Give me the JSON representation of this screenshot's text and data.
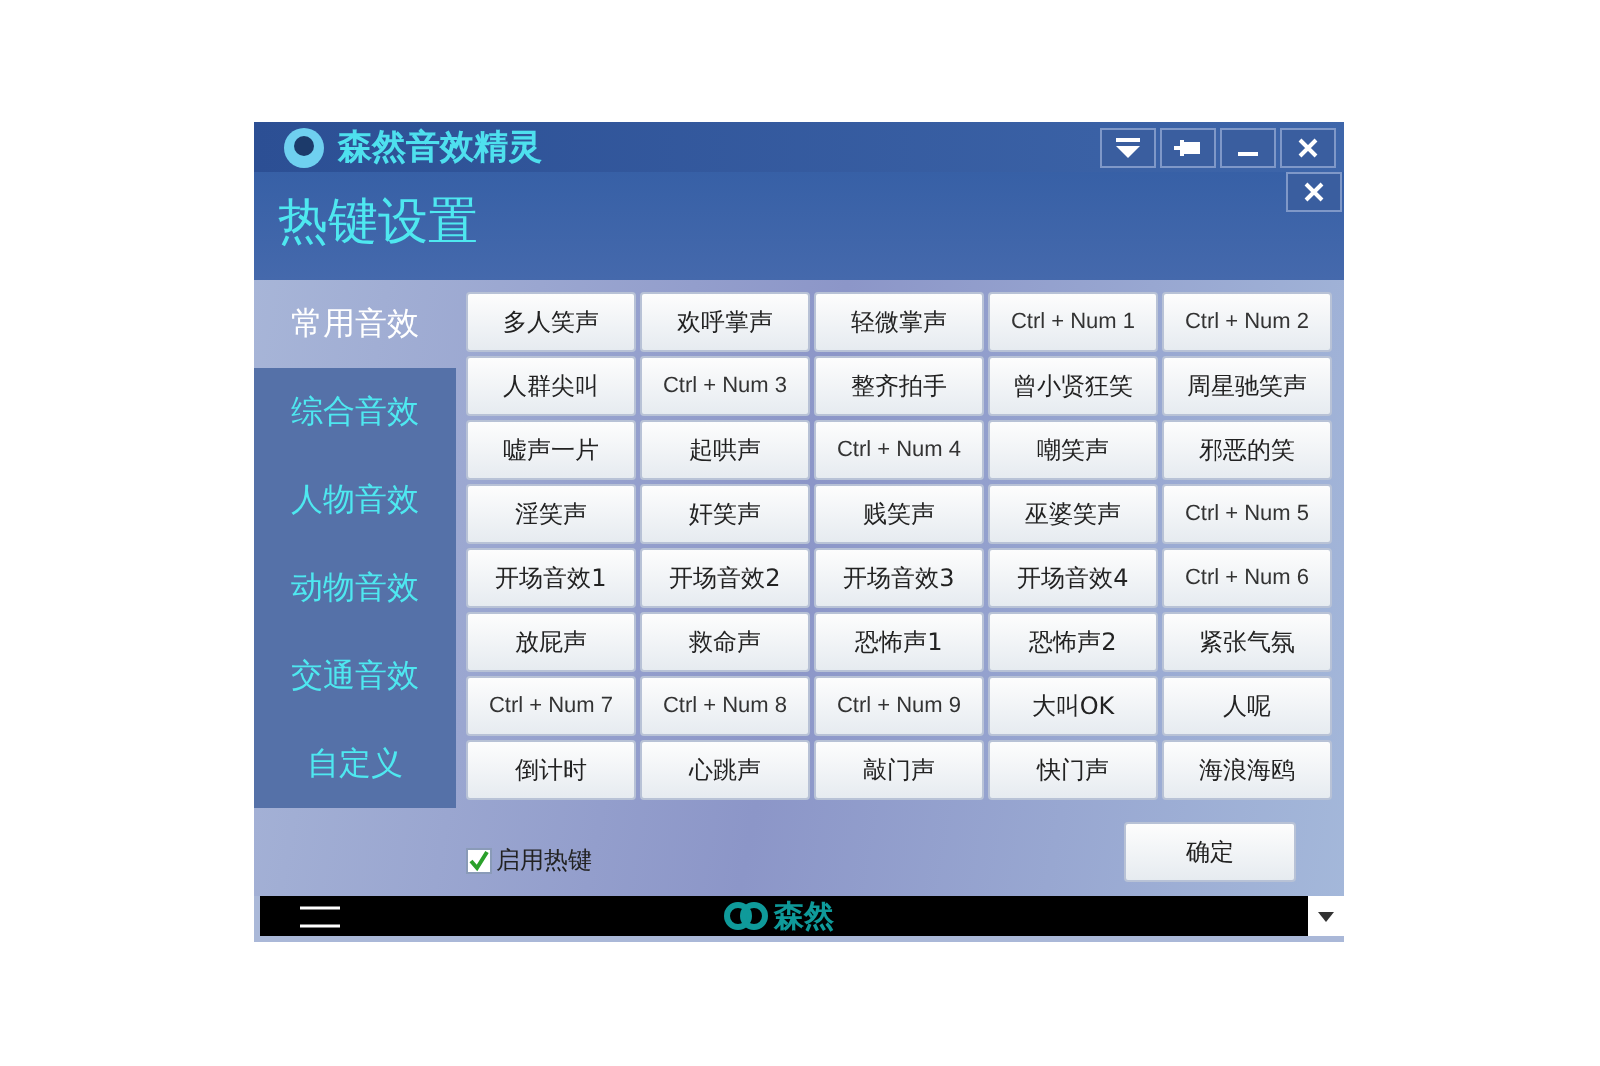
{
  "app_window": {
    "title": "森然音效精灵"
  },
  "dialog": {
    "title": "热键设置"
  },
  "categories": [
    {
      "label": "常用音效",
      "selected": true
    },
    {
      "label": "综合音效",
      "selected": false
    },
    {
      "label": "人物音效",
      "selected": false
    },
    {
      "label": "动物音效",
      "selected": false
    },
    {
      "label": "交通音效",
      "selected": false
    },
    {
      "label": "自定义",
      "selected": false
    }
  ],
  "sound_buttons": [
    "多人笑声",
    "欢呼掌声",
    "轻微掌声",
    "Ctrl + Num 1",
    "Ctrl + Num 2",
    "人群尖叫",
    "Ctrl + Num 3",
    "整齐拍手",
    "曾小贤狂笑",
    "周星驰笑声",
    "嘘声一片",
    "起哄声",
    "Ctrl + Num 4",
    "嘲笑声",
    "邪恶的笑",
    "淫笑声",
    "奸笑声",
    "贱笑声",
    "巫婆笑声",
    "Ctrl + Num 5",
    "开场音效1",
    "开场音效2",
    "开场音效3",
    "开场音效4",
    "Ctrl + Num 6",
    "放屁声",
    "救命声",
    "恐怖声1",
    "恐怖声2",
    "紧张气氛",
    "Ctrl + Num 7",
    "Ctrl + Num 8",
    "Ctrl + Num 9",
    "大叫OK",
    "人呢",
    "倒计时",
    "心跳声",
    "敲门声",
    "快门声",
    "海浪海鸥"
  ],
  "enable_hotkeys": {
    "label": "启用热键",
    "checked": true
  },
  "ok_button": "确定",
  "footer": {
    "logo_text": "森然"
  }
}
